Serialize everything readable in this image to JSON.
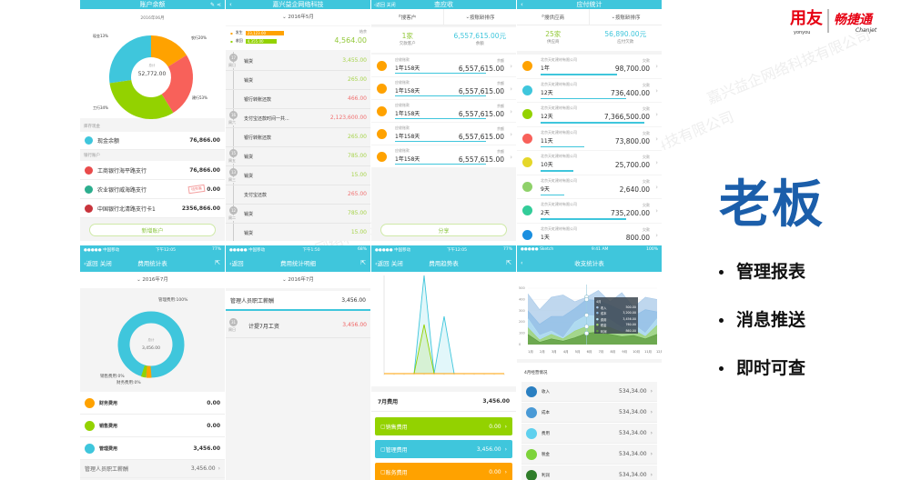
{
  "watermark": "嘉兴益企网络科技有限公司",
  "brand": {
    "logo1": "用友",
    "logo1_sub": "yonyou",
    "logo2": "畅捷通",
    "logo2_sub": "Chanjet",
    "color": "#e60012"
  },
  "slide": {
    "title": "老板",
    "bullets": [
      "管理报表",
      "消息推送",
      "即时可查"
    ],
    "title_color": "#1b5eaa"
  },
  "p1": {
    "title": "账户余额",
    "date": "2016年06月",
    "total_label": "总计",
    "total": "52,772.00",
    "slices": [
      {
        "label": "农行20%",
        "color": "#ffa200"
      },
      {
        "label": "建行53%",
        "color": "#f8615a"
      },
      {
        "label": "工行34%",
        "color": "#93d200"
      },
      {
        "label": "现金13%",
        "color": "#3fc6dc"
      }
    ],
    "cash_section": "库存现金",
    "cash": {
      "name": "现金余额",
      "amount": "76,866.00"
    },
    "bank_section": "银行账户",
    "banks": [
      {
        "name": "工商银行海平路支行",
        "amount": "76,866.00",
        "color": "#e94b4b"
      },
      {
        "name": "农业银行威海路支行",
        "amount": "0.00",
        "stamp": "待完善",
        "color": "#2cae8e"
      },
      {
        "name": "中国银行北清路支行卡1",
        "amount": "2356,866.00",
        "color": "#c8343c"
      }
    ],
    "button": "新增账户"
  },
  "p2": {
    "title": "嘉兴益企网络科技",
    "date": "2016年5月",
    "legend": [
      {
        "label": "发生",
        "value": "23,123.00",
        "color": "#ffa200"
      },
      {
        "label": "收回",
        "value": "4,355.00",
        "color": "#93d200"
      }
    ],
    "balance_label": "结余",
    "balance": "4,564.00",
    "rows": [
      {
        "day": "17",
        "weekday": "周日",
        "label": "销货",
        "amount": "3,455.00",
        "type": "in"
      },
      {
        "label": "销货",
        "amount": "265.00",
        "type": "in"
      },
      {
        "label": "银行转账还款",
        "amount": "466.00",
        "type": "out"
      },
      {
        "day": "16",
        "weekday": "周六",
        "label": "支付宝还款时间一共...",
        "amount": "2,123,600.00",
        "type": "out"
      },
      {
        "label": "银行转账还款",
        "amount": "265.00",
        "type": "in"
      },
      {
        "day": "15",
        "weekday": "周五",
        "label": "销货",
        "amount": "785.00",
        "type": "in"
      },
      {
        "day": "13",
        "weekday": "周三",
        "label": "销货",
        "amount": "15.00",
        "type": "in"
      },
      {
        "label": "支付宝还款",
        "amount": "265.00",
        "type": "out"
      },
      {
        "day": "12",
        "weekday": "周二",
        "label": "销货",
        "amount": "785.00",
        "type": "in"
      },
      {
        "label": "销货",
        "amount": "15.00",
        "type": "in"
      }
    ]
  },
  "p3": {
    "back": "返回",
    "close": "关闭",
    "title": "查应收",
    "search": "搜客户",
    "sort": "按账龄排序",
    "count": "1家",
    "count_label": "欠款客户",
    "total": "6,557,615.00元",
    "total_label": "余额",
    "rows": [
      {
        "type": "应收账款",
        "age": "1年158天",
        "label": "余额",
        "amount": "6,557,615.00",
        "fill": 1
      },
      {
        "type": "应收账款",
        "age": "1年158天",
        "label": "余额",
        "amount": "6,557,615.00",
        "fill": 1
      },
      {
        "type": "应收账款",
        "age": "1年158天",
        "label": "余额",
        "amount": "6,557,615.00",
        "fill": 1
      },
      {
        "type": "应收账款",
        "age": "1年158天",
        "label": "余额",
        "amount": "6,557,615.00",
        "fill": 1
      },
      {
        "type": "应收账款",
        "age": "1年158天",
        "label": "余额",
        "amount": "6,557,615.00",
        "fill": 1
      }
    ],
    "button": "分享"
  },
  "p4": {
    "title": "应付统计",
    "search": "搜供应商",
    "sort": "按账龄排序",
    "count": "25家",
    "count_label": "供应商",
    "total": "56,890.00元",
    "total_label": "应付欠款",
    "rows": [
      {
        "name": "北京天虹建材有限公司",
        "age": "1年",
        "label": "欠款",
        "amount": "98,700.00",
        "fill": 0.7,
        "color": "#ffa200"
      },
      {
        "name": "北京天虹建材有限公司",
        "age": "12天",
        "label": "欠款",
        "amount": "736,400.00",
        "fill": 0.78,
        "color": "#3fc6dc"
      },
      {
        "name": "北京天虹建材有限公司",
        "age": "12天",
        "label": "欠款",
        "amount": "7,366,500.00",
        "fill": 0.95,
        "color": "#93d200"
      },
      {
        "name": "北京天虹建材有限公司",
        "age": "11天",
        "label": "欠款",
        "amount": "73,800.00",
        "fill": 0.4,
        "color": "#f8615a"
      },
      {
        "name": "北京天虹建材有限公司",
        "age": "10天",
        "label": "欠款",
        "amount": "25,700.00",
        "fill": 0.3,
        "color": "#e5d72a"
      },
      {
        "name": "北京天虹建材有限公司",
        "age": "9天",
        "label": "欠款",
        "amount": "2,640.00",
        "fill": 0.22,
        "color": "#8fd16a"
      },
      {
        "name": "北京天虹建材有限公司",
        "age": "2天",
        "label": "欠款",
        "amount": "735,200.00",
        "fill": 0.78,
        "color": "#33cc99"
      },
      {
        "name": "北京天虹建材有限公司",
        "age": "1天",
        "label": "欠款",
        "amount": "800.00",
        "fill": 0.14,
        "color": "#1a8fe0"
      }
    ]
  },
  "p5": {
    "status": {
      "carrier": "●●●●● 中国移动",
      "time": "下午12:05",
      "battery": "77%"
    },
    "back": "返回",
    "close": "关闭",
    "title": "费用统计表",
    "date": "2016年7月",
    "total_label": "总计",
    "total": "3,456.00",
    "labels": {
      "main": "管理费用:100%",
      "sales": "销售费用:0%",
      "finance": "财务费用:0%"
    },
    "rows": [
      {
        "name": "财务费用",
        "amount": "0.00",
        "color": "#ffa200"
      },
      {
        "name": "销售费用",
        "amount": "0.00",
        "color": "#93d200"
      },
      {
        "name": "管理费用",
        "amount": "3,456.00",
        "color": "#3fc6dc"
      }
    ],
    "detail": {
      "name": "管理人员职工薪酬",
      "amount": "3,456.00"
    }
  },
  "p6": {
    "status": {
      "carrier": "●●●●● 中国移动",
      "time": "下午1:50",
      "battery": "68%"
    },
    "back": "返回",
    "title": "费用统计明细",
    "date": "2016年7月",
    "summary": {
      "name": "管理人员职工薪酬",
      "amount": "3,456.00"
    },
    "entry": {
      "day": "31",
      "weekday": "周日",
      "label": "计提7月工资",
      "amount": "3,456.00"
    }
  },
  "p7": {
    "status": {
      "carrier": "●●●●● 中国移动",
      "time": "下午12:05",
      "battery": "77%"
    },
    "back": "返回",
    "close": "关闭",
    "title": "费用趋势表",
    "month_label": "7月费用",
    "month_total": "3,456.00",
    "bars": [
      {
        "name": "销售费用",
        "amount": "0.00",
        "color": "#93d200"
      },
      {
        "name": "管理费用",
        "amount": "3,456.00",
        "color": "#3fc6dc"
      },
      {
        "name": "账务费用",
        "amount": "0.00",
        "color": "#ffa200"
      }
    ]
  },
  "p8": {
    "status": {
      "carrier": "●●●●● Sketch",
      "time": "9:41 AM",
      "battery": "100%"
    },
    "title": "收支统计表",
    "tooltip": {
      "title": "4月",
      "items": [
        {
          "name": "收入",
          "value": "500.00"
        },
        {
          "name": "成本",
          "value": "3,200.00"
        },
        {
          "name": "费用",
          "value": "3,456.00"
        },
        {
          "name": "税金",
          "value": "760.00"
        },
        {
          "name": "利润",
          "value": "860.00"
        }
      ]
    },
    "section": "4月经营情况",
    "rows": [
      {
        "name": "收入",
        "amount": "534,34.00",
        "color": "#2a7fc1"
      },
      {
        "name": "成本",
        "amount": "534,34.00",
        "color": "#4a9ad6"
      },
      {
        "name": "费用",
        "amount": "534,34.00",
        "color": "#5fd0ee"
      },
      {
        "name": "税金",
        "amount": "534,34.00",
        "color": "#7dd33a"
      },
      {
        "name": "利润",
        "amount": "534,34.00",
        "color": "#2f7d2a"
      }
    ]
  },
  "chart_data": [
    {
      "type": "line",
      "x": [
        0,
        1,
        2,
        3,
        4,
        5,
        6,
        7,
        8,
        9,
        10,
        11,
        12
      ],
      "ylim": [
        0,
        600
      ],
      "series": [
        {
          "values": [
            0,
            0,
            0,
            0,
            600,
            0,
            350,
            0,
            0,
            0,
            0,
            0,
            0
          ],
          "color": "#3fc6dc"
        },
        {
          "values": [
            0,
            0,
            0,
            0,
            300,
            0,
            0,
            0,
            0,
            0,
            0,
            0,
            0
          ],
          "color": "#93d200"
        },
        {
          "values": [
            0,
            0,
            0,
            0,
            0,
            0,
            0,
            0,
            0,
            0,
            0,
            0,
            0
          ],
          "color": "#ffa200"
        }
      ]
    },
    {
      "type": "area",
      "categories": [
        "1月",
        "2月",
        "3月",
        "4月",
        "5月",
        "6月",
        "7月",
        "8月",
        "9月",
        "10月",
        "11月",
        "12月"
      ],
      "yticks": [
        0,
        100,
        200,
        300,
        400,
        500
      ],
      "ylim": [
        0,
        500
      ],
      "series": [
        {
          "name": "收入",
          "values": [
            450,
            310,
            420,
            440,
            380,
            420,
            480,
            380,
            460,
            330,
            420,
            400
          ],
          "color": "#a9c9e8"
        },
        {
          "name": "成本",
          "values": [
            300,
            180,
            250,
            250,
            320,
            400,
            390,
            350,
            300,
            250,
            310,
            290
          ],
          "color": "#8fbde6"
        },
        {
          "name": "费用",
          "values": [
            230,
            80,
            120,
            60,
            200,
            260,
            250,
            220,
            150,
            180,
            100,
            230
          ],
          "color": "#b6e2f3"
        },
        {
          "name": "税金",
          "values": [
            150,
            40,
            90,
            50,
            120,
            160,
            170,
            150,
            110,
            130,
            70,
            170
          ],
          "color": "#9fd46b"
        },
        {
          "name": "利润",
          "values": [
            90,
            20,
            50,
            30,
            60,
            100,
            110,
            90,
            70,
            80,
            50,
            90
          ],
          "color": "#5b9a3c"
        }
      ]
    }
  ]
}
